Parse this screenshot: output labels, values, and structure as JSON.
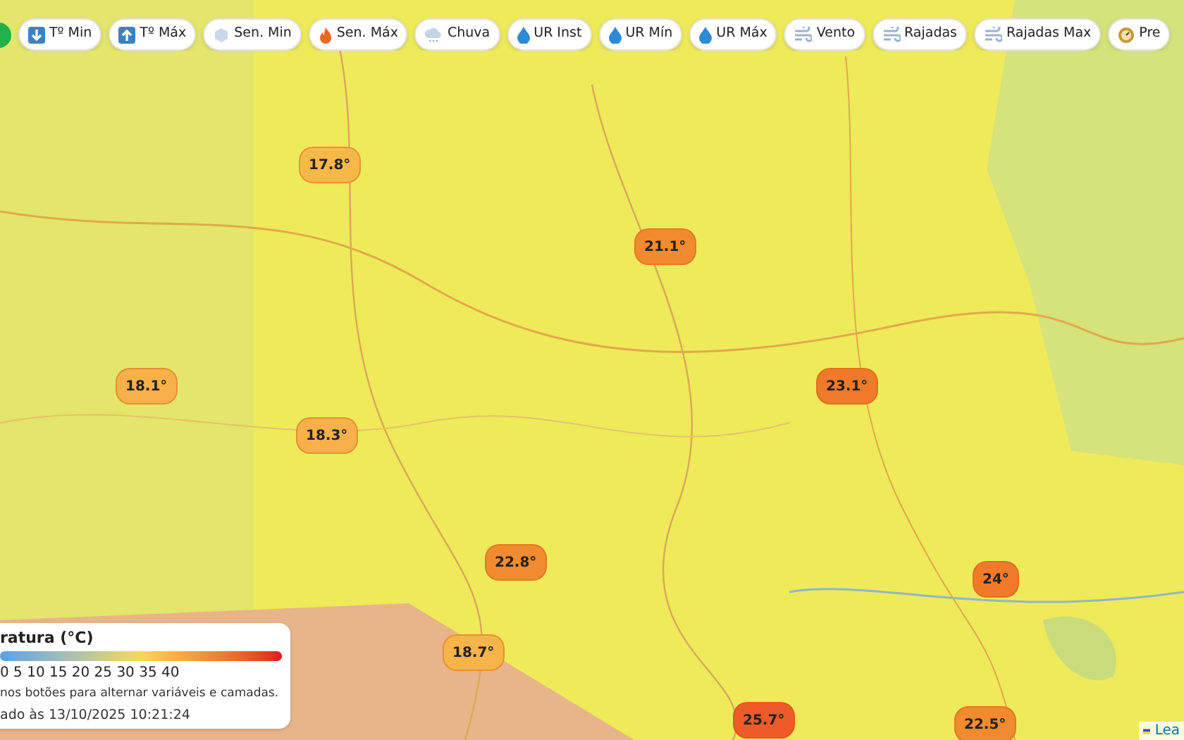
{
  "toolbar": {
    "buttons": [
      {
        "kind": "down",
        "label": "Tº Min"
      },
      {
        "kind": "up",
        "label": "Tº Máx"
      },
      {
        "kind": "snow",
        "label": "Sen. Min"
      },
      {
        "kind": "fire",
        "label": "Sen. Máx"
      },
      {
        "kind": "rain",
        "label": "Chuva"
      },
      {
        "kind": "drop",
        "label": "UR Inst"
      },
      {
        "kind": "drop",
        "label": "UR Mín"
      },
      {
        "kind": "drop",
        "label": "UR Máx"
      },
      {
        "kind": "wind",
        "label": "Vento"
      },
      {
        "kind": "wind",
        "label": "Rajadas"
      },
      {
        "kind": "wind",
        "label": "Rajadas Max"
      },
      {
        "kind": "gauge",
        "label": "Pre"
      }
    ]
  },
  "map": {
    "markers": [
      {
        "text": "17.8°",
        "color": "#f7b84a"
      },
      {
        "text": "21.1°",
        "color": "#f28b30"
      },
      {
        "text": "18.1°",
        "color": "#f7b04a"
      },
      {
        "text": "18.3°",
        "color": "#f7b04a"
      },
      {
        "text": "23.1°",
        "color": "#f07a2a"
      },
      {
        "text": "22.8°",
        "color": "#f28a30"
      },
      {
        "text": "18.7°",
        "color": "#f6b44a"
      },
      {
        "text": "24°",
        "color": "#f07a2a"
      },
      {
        "text": "25.7°",
        "color": "#ee5a28"
      },
      {
        "text": "22.5°",
        "color": "#f28a30"
      }
    ]
  },
  "legend": {
    "title": "ratura (°C)",
    "scale": "0 5 10 15 20 25 30 35 40",
    "hint": "nos botões para alternar variáveis e camadas.",
    "updated": "ado às 13/10/2025 10:21:24"
  },
  "attribution": "Lea"
}
